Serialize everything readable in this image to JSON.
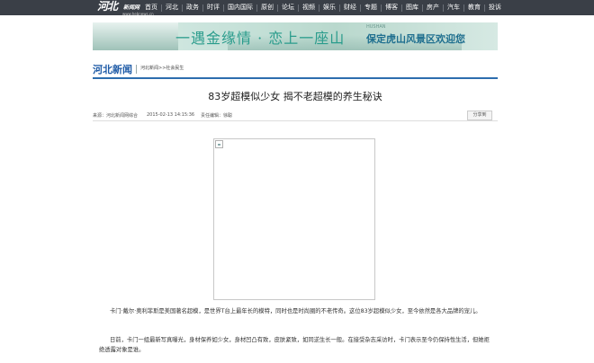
{
  "logo": {
    "text": "河北",
    "en": "新闻网",
    "sub": "www.hebnews.cn"
  },
  "nav": [
    "首页",
    "河北",
    "政务",
    "时评",
    "国内国际",
    "原创",
    "论坛",
    "视频",
    "娱乐",
    "财经",
    "专题",
    "博客",
    "图库",
    "房产",
    "汽车",
    "教育",
    "投诉"
  ],
  "banner": {
    "slogan": "一遇金缘情 · 恋上一座山",
    "en": "HUSHAN",
    "title": "保定虎山风景区欢迎您"
  },
  "section": {
    "title": "河北新闻",
    "breadcrumb_1": "河北新闻",
    "breadcrumb_sep": ">>",
    "breadcrumb_2": "社会民生"
  },
  "article": {
    "title": "83岁超模似少女 揭不老超模的养生秘诀",
    "source": "来源：河北新闻网综合",
    "datetime": "2015-02-13 14:15:36",
    "editor": "责任编辑：徐聪",
    "share": "分享到",
    "para1": "卡门·戴尔·奥利菲斯是美国著名超模，是世界T台上最年长的模特，同时也是时尚圈的不老传奇。这位83岁超模似少女，至今依然是各大品牌的宠儿。",
    "para2": "日前，卡门一组最新写真曝光，身材保养如少女，身材凹凸有致，皮肤紧致，如同逆生长一般。在接受杂志采访时，卡门表示至今仍保持性生活，但她拒绝透露对象是谁。"
  }
}
